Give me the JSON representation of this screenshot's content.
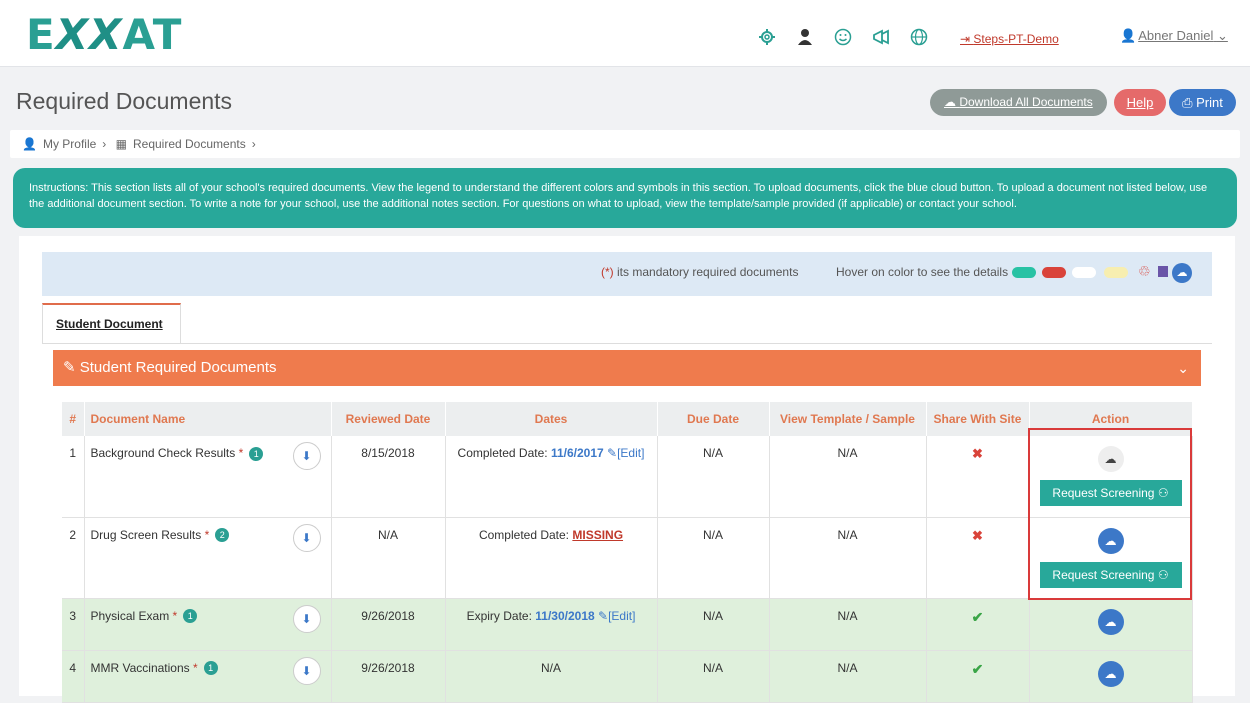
{
  "brand": {
    "logo_text_1": "E",
    "logo_text_2": "XX",
    "logo_text_3": "AT"
  },
  "header": {
    "icons": [
      "gear-icon",
      "user-avatar-icon",
      "smile-icon",
      "megaphone-icon",
      "globe-icon"
    ],
    "steps_link": "Steps-PT-Demo",
    "user_name": "Abner Daniel"
  },
  "page": {
    "title": "Required Documents",
    "download_all": "Download All Documents",
    "help": "Help",
    "print": "Print"
  },
  "breadcrumb": [
    "My Profile",
    "Required Documents"
  ],
  "instructions": "Instructions: This section lists all of your school's required documents. View the legend to understand the different colors and symbols in this section. To upload documents, click the blue cloud button. To upload a document not listed below, use the additional document section. To write a note for your school, use the additional notes section. For questions on what to upload, view the template/sample provided (if applicable) or contact your school.",
  "legend": {
    "mandatory_star": "(*)",
    "mandatory_text": "its mandatory required documents",
    "hover_text": "Hover on color to see the details",
    "colors": [
      "#28c2a4",
      "#d9433a",
      "#ffffff",
      "#f7eeb0"
    ]
  },
  "tabs": [
    {
      "label": "Student Document"
    }
  ],
  "panel": {
    "title": "Student Required Documents"
  },
  "table": {
    "headers": [
      "#",
      "Document Name",
      "Reviewed Date",
      "Dates",
      "Due Date",
      "View Template / Sample",
      "Share With Site",
      "Action"
    ],
    "rows": [
      {
        "num": "1",
        "name": "Background Check Results",
        "badge": "1",
        "reviewed": "8/15/2018",
        "dates_label": "Completed Date:",
        "dates_value": "11/6/2017",
        "edit": "[Edit]",
        "due": "N/A",
        "template": "N/A",
        "share": "✖",
        "request": "Request Screening"
      },
      {
        "num": "2",
        "name": "Drug Screen Results",
        "badge": "2",
        "reviewed": "N/A",
        "dates_label": "Completed Date:",
        "dates_value": "MISSING",
        "due": "N/A",
        "template": "N/A",
        "share": "✖",
        "request": "Request Screening"
      },
      {
        "num": "3",
        "name": "Physical Exam",
        "badge": "1",
        "reviewed": "9/26/2018",
        "dates_label": "Expiry Date:",
        "dates_value": "11/30/2018",
        "edit": "[Edit]",
        "due": "N/A",
        "template": "N/A",
        "share": "✔"
      },
      {
        "num": "4",
        "name": "MMR Vaccinations",
        "badge": "1",
        "reviewed": "9/26/2018",
        "dates_plain": "N/A",
        "due": "N/A",
        "template": "N/A",
        "share": "✔"
      }
    ]
  }
}
